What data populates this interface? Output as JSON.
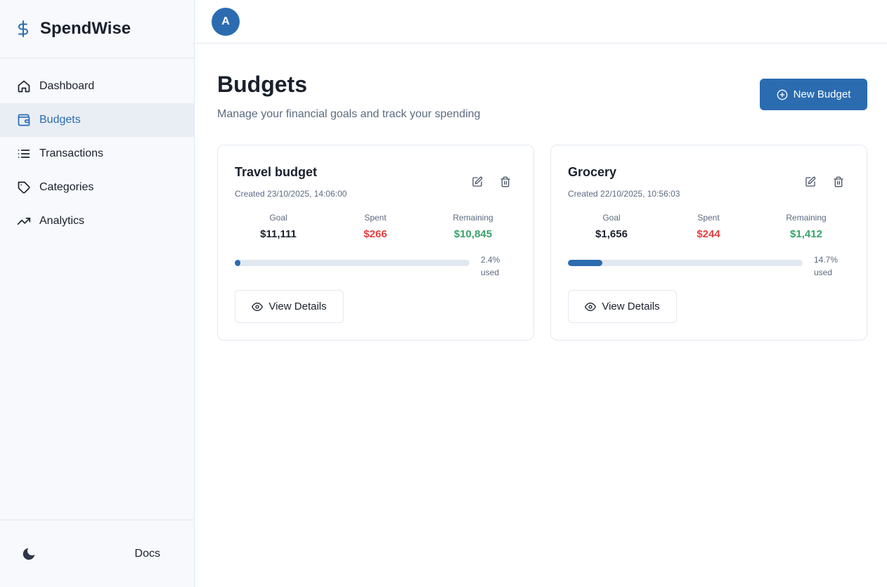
{
  "app": {
    "name": "SpendWise",
    "accent": "#2b6cb0"
  },
  "sidebar": {
    "items": [
      {
        "label": "Dashboard",
        "icon": "home-icon"
      },
      {
        "label": "Budgets",
        "icon": "wallet-icon",
        "active": true
      },
      {
        "label": "Transactions",
        "icon": "list-icon"
      },
      {
        "label": "Categories",
        "icon": "tag-icon"
      },
      {
        "label": "Analytics",
        "icon": "trending-up-icon"
      }
    ],
    "footer": {
      "theme_icon": "moon-icon",
      "docs_label": "Docs"
    }
  },
  "topbar": {
    "avatar_initial": "A"
  },
  "page": {
    "title": "Budgets",
    "subtitle": "Manage your financial goals and track your spending",
    "new_button_label": "New Budget"
  },
  "labels": {
    "goal": "Goal",
    "spent": "Spent",
    "remaining": "Remaining",
    "used": "used",
    "view_details": "View Details"
  },
  "budgets": [
    {
      "title": "Travel budget",
      "created": "Created 23/10/2025, 14:06:00",
      "goal": "$11,111",
      "spent": "$266",
      "remaining": "$10,845",
      "percent_text": "2.4%",
      "percent": 2.4
    },
    {
      "title": "Grocery",
      "created": "Created 22/10/2025, 10:56:03",
      "goal": "$1,656",
      "spent": "$244",
      "remaining": "$1,412",
      "percent_text": "14.7%",
      "percent": 14.7
    }
  ]
}
